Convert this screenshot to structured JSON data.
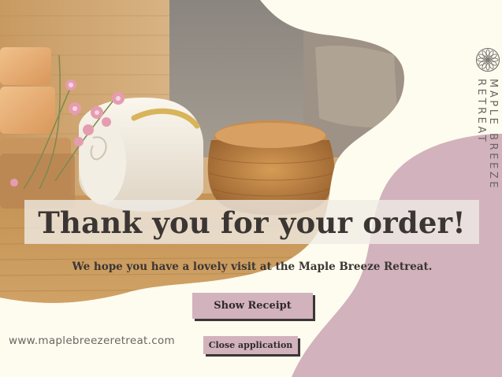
{
  "brand": {
    "name_vertical": "MAPLE BREEZE RETREAT",
    "logo_icon": "flower-mandala-icon",
    "website": "www.maplebreezeretreat.com"
  },
  "main": {
    "headline": "Thank you for your order!",
    "subline": "We hope you have a lovely visit at the Maple Breeze Retreat."
  },
  "actions": {
    "show_receipt_label": "Show Receipt",
    "close_application_label": "Close application"
  },
  "colors": {
    "background": "#fdfcef",
    "accent_pink": "#d2b2bd",
    "text_dark": "#3b3633",
    "text_muted": "#6b6563"
  }
}
